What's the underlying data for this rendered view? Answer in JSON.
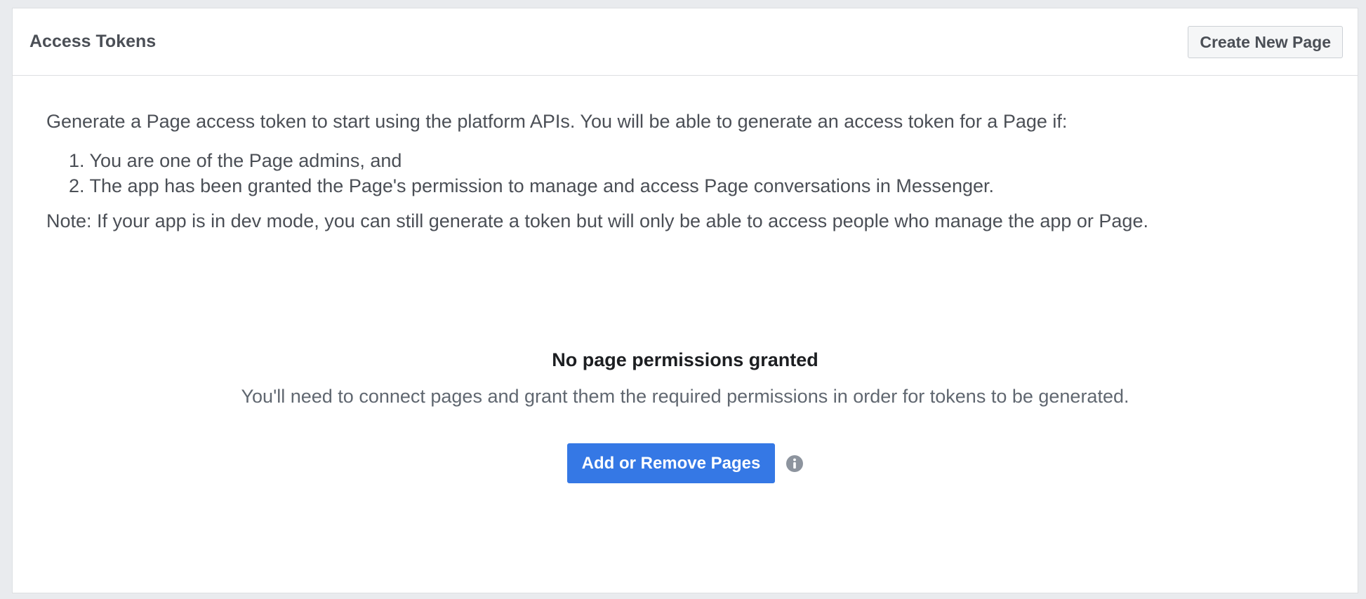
{
  "header": {
    "title": "Access Tokens",
    "create_button_label": "Create New Page"
  },
  "body": {
    "intro": "Generate a Page access token to start using the platform APIs. You will be able to generate an access token for a Page if:",
    "conditions": [
      "1. You are one of the Page admins, and",
      "2. The app has been granted the Page's permission to manage and access Page conversations in Messenger."
    ],
    "note": "Note: If your app is in dev mode, you can still generate a token but will only be able to access people who manage the app or Page."
  },
  "empty_state": {
    "title": "No page permissions granted",
    "description": "You'll need to connect pages and grant them the required permissions in order for tokens to be generated.",
    "primary_button_label": "Add or Remove Pages",
    "info_icon": "info-icon"
  },
  "colors": {
    "primary": "#3578e5",
    "background": "#e9ebee",
    "text": "#4b4f56",
    "heading": "#1c1e21",
    "info_icon": "#8d949e"
  }
}
